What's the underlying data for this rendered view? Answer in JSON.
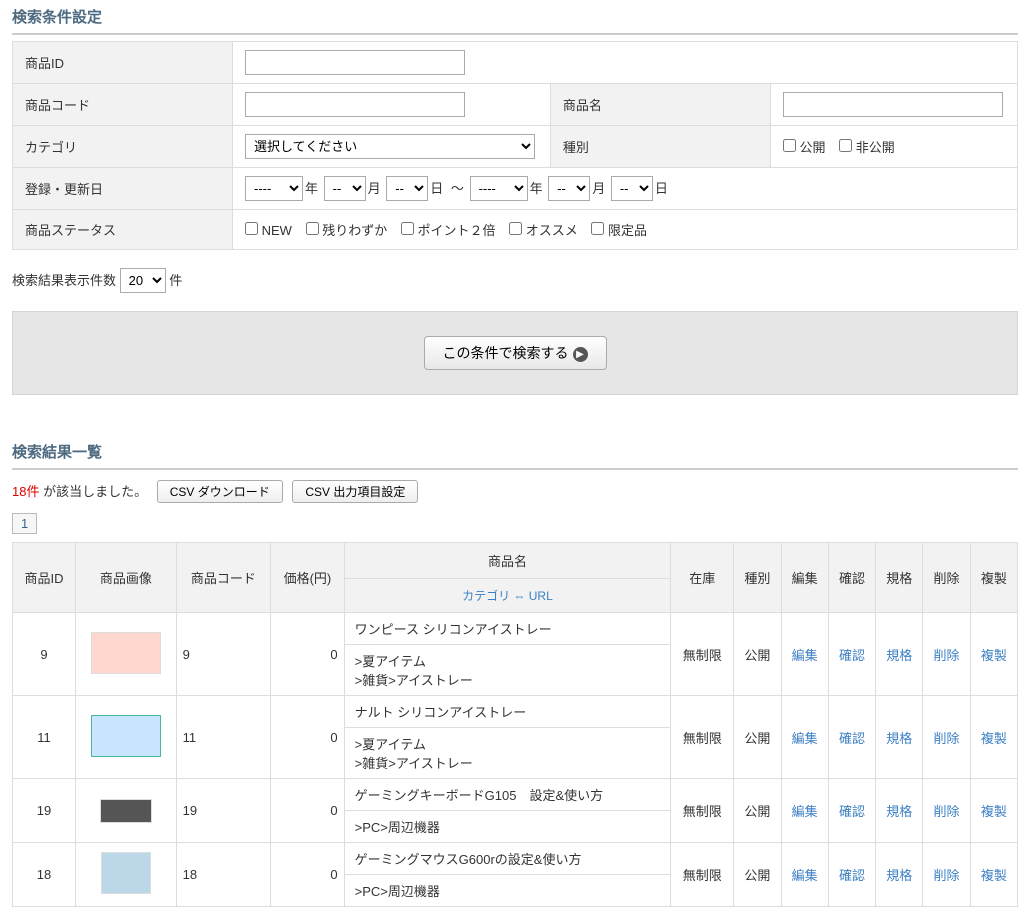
{
  "section_search": "検索条件設定",
  "form": {
    "product_id_label": "商品ID",
    "product_code_label": "商品コード",
    "product_name_label": "商品名",
    "category_label": "カテゴリ",
    "category_placeholder": "選択してください",
    "kind_label": "種別",
    "kind_public": "公開",
    "kind_private": "非公開",
    "date_label": "登録・更新日",
    "date_dash": "----",
    "date_small": "--",
    "year": "年",
    "month": "月",
    "day": "日",
    "tilde": "～",
    "status_label": "商品ステータス",
    "status_new": "NEW",
    "status_low": "残りわずか",
    "status_point2": "ポイント２倍",
    "status_osusume": "オススメ",
    "status_limited": "限定品"
  },
  "page_count_label": "検索結果表示件数",
  "page_count_value": "20",
  "page_count_unit": "件",
  "search_button": "この条件で検索する",
  "section_results": "検索結果一覧",
  "result_count": "18件",
  "result_text": " が該当しました。",
  "csv_download": "CSV ダウンロード",
  "csv_settings": "CSV 出力項目設定",
  "page_num": "1",
  "cols": {
    "id": "商品ID",
    "image": "商品画像",
    "code": "商品コード",
    "price": "価格(円)",
    "name": "商品名",
    "cat_url": "カテゴリ ⇔ URL",
    "stock": "在庫",
    "kind": "種別",
    "edit": "編集",
    "confirm": "確認",
    "spec": "規格",
    "delete": "削除",
    "copy": "複製"
  },
  "rows": [
    {
      "id": "9",
      "code": "9",
      "price": "0",
      "name": "ワンピース シリコンアイストレー",
      "cat": ">夏アイテム\n>雑貨>アイストレー",
      "stock": "無制限",
      "kind": "公開",
      "img": "red"
    },
    {
      "id": "11",
      "code": "11",
      "price": "0",
      "name": "ナルト シリコンアイストレー",
      "cat": ">夏アイテム\n>雑貨>アイストレー",
      "stock": "無制限",
      "kind": "公開",
      "img": "nav"
    },
    {
      "id": "19",
      "code": "19",
      "price": "0",
      "name": "ゲーミングキーボードG105　設定&使い方",
      "cat": ">PC>周辺機器",
      "stock": "無制限",
      "kind": "公開",
      "img": "dark"
    },
    {
      "id": "18",
      "code": "18",
      "price": "0",
      "name": "ゲーミングマウスG600rの設定&使い方",
      "cat": ">PC>周辺機器",
      "stock": "無制限",
      "kind": "公開",
      "img": "box"
    }
  ],
  "actions": {
    "edit": "編集",
    "confirm": "確認",
    "spec": "規格",
    "delete": "削除",
    "copy": "複製"
  }
}
